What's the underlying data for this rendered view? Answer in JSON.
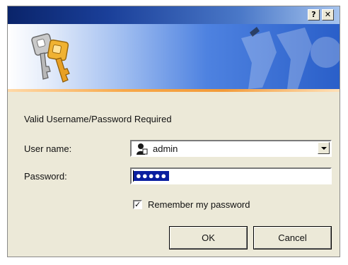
{
  "titlebar": {
    "help_glyph": "?",
    "close_glyph": "✕"
  },
  "colors": {
    "title_gradient_start": "#0a246a",
    "banner_blue": "#4e82e0",
    "accent_strip": "#f29a38",
    "selection": "#0a1fa0",
    "dialog_face": "#ece9d8"
  },
  "icons": {
    "banner": "keys-icon",
    "user_field": "user-icon"
  },
  "dialog": {
    "heading": "Valid Username/Password Required",
    "username_label": "User name:",
    "username_value": "admin",
    "password_label": "Password:",
    "password_value": "●●●●●",
    "remember_label": "Remember my password",
    "remember_checked_mark": "✓",
    "ok_label": "OK",
    "cancel_label": "Cancel"
  }
}
